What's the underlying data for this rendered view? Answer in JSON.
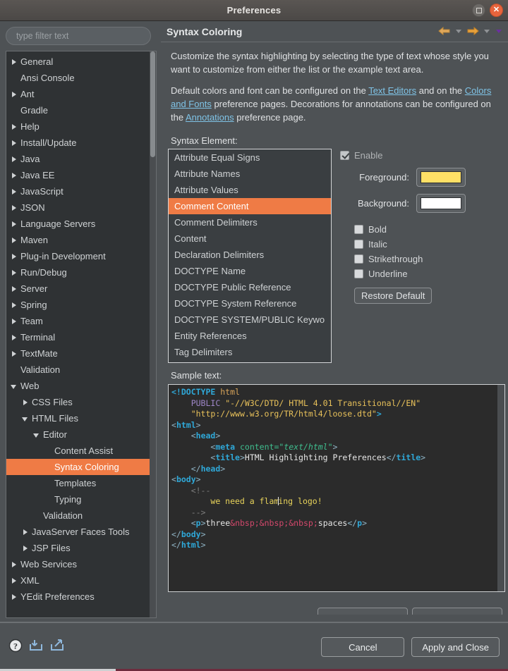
{
  "window": {
    "title": "Preferences",
    "maximize_icon": "maximize-icon",
    "close_icon": "close-icon"
  },
  "sidebar": {
    "filter_placeholder": "type filter text",
    "filter_value": "",
    "items": [
      {
        "label": "General",
        "indent": 0,
        "arrow": "closed",
        "selected": false
      },
      {
        "label": "Ansi Console",
        "indent": 0,
        "arrow": "none",
        "selected": false
      },
      {
        "label": "Ant",
        "indent": 0,
        "arrow": "closed",
        "selected": false
      },
      {
        "label": "Gradle",
        "indent": 0,
        "arrow": "none",
        "selected": false
      },
      {
        "label": "Help",
        "indent": 0,
        "arrow": "closed",
        "selected": false
      },
      {
        "label": "Install/Update",
        "indent": 0,
        "arrow": "closed",
        "selected": false
      },
      {
        "label": "Java",
        "indent": 0,
        "arrow": "closed",
        "selected": false
      },
      {
        "label": "Java EE",
        "indent": 0,
        "arrow": "closed",
        "selected": false
      },
      {
        "label": "JavaScript",
        "indent": 0,
        "arrow": "closed",
        "selected": false
      },
      {
        "label": "JSON",
        "indent": 0,
        "arrow": "closed",
        "selected": false
      },
      {
        "label": "Language Servers",
        "indent": 0,
        "arrow": "closed",
        "selected": false
      },
      {
        "label": "Maven",
        "indent": 0,
        "arrow": "closed",
        "selected": false
      },
      {
        "label": "Plug-in Development",
        "indent": 0,
        "arrow": "closed",
        "selected": false
      },
      {
        "label": "Run/Debug",
        "indent": 0,
        "arrow": "closed",
        "selected": false
      },
      {
        "label": "Server",
        "indent": 0,
        "arrow": "closed",
        "selected": false
      },
      {
        "label": "Spring",
        "indent": 0,
        "arrow": "closed",
        "selected": false
      },
      {
        "label": "Team",
        "indent": 0,
        "arrow": "closed",
        "selected": false
      },
      {
        "label": "Terminal",
        "indent": 0,
        "arrow": "closed",
        "selected": false
      },
      {
        "label": "TextMate",
        "indent": 0,
        "arrow": "closed",
        "selected": false
      },
      {
        "label": "Validation",
        "indent": 0,
        "arrow": "none",
        "selected": false
      },
      {
        "label": "Web",
        "indent": 0,
        "arrow": "open",
        "selected": false
      },
      {
        "label": "CSS Files",
        "indent": 1,
        "arrow": "closed",
        "selected": false
      },
      {
        "label": "HTML Files",
        "indent": 1,
        "arrow": "open",
        "selected": false
      },
      {
        "label": "Editor",
        "indent": 2,
        "arrow": "open",
        "selected": false
      },
      {
        "label": "Content Assist",
        "indent": 3,
        "arrow": "none",
        "selected": false
      },
      {
        "label": "Syntax Coloring",
        "indent": 3,
        "arrow": "none",
        "selected": true
      },
      {
        "label": "Templates",
        "indent": 3,
        "arrow": "none",
        "selected": false
      },
      {
        "label": "Typing",
        "indent": 3,
        "arrow": "none",
        "selected": false
      },
      {
        "label": "Validation",
        "indent": 2,
        "arrow": "none",
        "selected": false
      },
      {
        "label": "JavaServer Faces Tools",
        "indent": 1,
        "arrow": "closed",
        "selected": false
      },
      {
        "label": "JSP Files",
        "indent": 1,
        "arrow": "closed",
        "selected": false
      },
      {
        "label": "Web Services",
        "indent": 0,
        "arrow": "closed",
        "selected": false
      },
      {
        "label": "XML",
        "indent": 0,
        "arrow": "closed",
        "selected": false
      },
      {
        "label": "YEdit Preferences",
        "indent": 0,
        "arrow": "closed",
        "selected": false
      }
    ]
  },
  "page": {
    "title": "Syntax Coloring",
    "nav": {
      "back_icon": "back-arrow-icon",
      "back_menu_icon": "chevron-down-icon",
      "forward_icon": "forward-arrow-icon",
      "forward_menu_icon": "chevron-down-icon",
      "view_menu_icon": "chevron-down-icon"
    },
    "description": {
      "para1": "Customize the syntax highlighting by selecting the type of text whose style you want to customize from either the list or the example text area.",
      "para2_a": "Default colors and font can be configured on the ",
      "link_text_editors": "Text Editors",
      "para2_b": " and on the ",
      "link_colors_fonts": "Colors and Fonts",
      "para2_c": " preference pages.  Decorations for annotations can be configured on the ",
      "link_annotations": "Annotations",
      "para2_d": " preference page."
    },
    "syntax_element_label": "Syntax Element:",
    "syntax_elements": [
      {
        "label": "Attribute Equal Signs",
        "selected": false
      },
      {
        "label": "Attribute Names",
        "selected": false
      },
      {
        "label": "Attribute Values",
        "selected": false
      },
      {
        "label": "Comment Content",
        "selected": true
      },
      {
        "label": "Comment Delimiters",
        "selected": false
      },
      {
        "label": "Content",
        "selected": false
      },
      {
        "label": "Declaration Delimiters",
        "selected": false
      },
      {
        "label": "DOCTYPE Name",
        "selected": false
      },
      {
        "label": "DOCTYPE Public Reference",
        "selected": false
      },
      {
        "label": "DOCTYPE System Reference",
        "selected": false
      },
      {
        "label": "DOCTYPE SYSTEM/PUBLIC Keywo",
        "selected": false
      },
      {
        "label": "Entity References",
        "selected": false
      },
      {
        "label": "Tag Delimiters",
        "selected": false
      }
    ],
    "style": {
      "enable_label": "Enable",
      "enable_checked": true,
      "foreground_label": "Foreground:",
      "foreground_color": "#FFE066",
      "background_label": "Background:",
      "background_color": "#FFFFFF",
      "bold_label": "Bold",
      "bold_checked": false,
      "italic_label": "Italic",
      "italic_checked": false,
      "strikethrough_label": "Strikethrough",
      "strikethrough_checked": false,
      "underline_label": "Underline",
      "underline_checked": false,
      "restore_default_label": "Restore Default"
    },
    "sample_text_label": "Sample text:",
    "sample_code_lines": [
      "<!DOCTYPE html",
      "    PUBLIC \"-//W3C/DTD/ HTML 4.01 Transitional//EN\"",
      "    \"http://www.w3.org/TR/html4/loose.dtd\">",
      "<html>",
      "    <head>",
      "        <meta content=\"text/html\">",
      "        <title>HTML Highlighting Preferences</title>",
      "    </head>",
      "<body>",
      "    <!--",
      "        we need a flaming logo!",
      "    -->",
      "    <p>three&nbsp;&nbsp;&nbsp;spaces</p>",
      "</body>",
      "</html>"
    ]
  },
  "footer": {
    "help_icon": "help-icon",
    "import_icon": "import-icon",
    "export_icon": "export-icon",
    "cancel_label": "Cancel",
    "apply_close_label": "Apply and Close"
  }
}
